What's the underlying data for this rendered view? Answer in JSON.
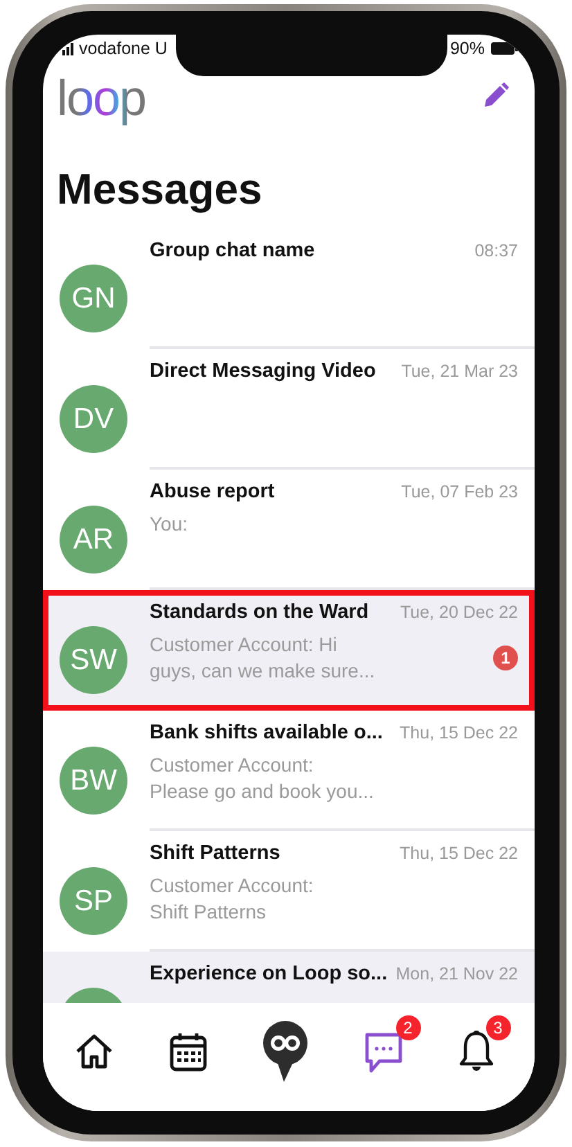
{
  "status_bar": {
    "carrier": "vodafone U",
    "battery": "90%"
  },
  "header": {
    "logo": "loop",
    "title": "Messages"
  },
  "conversations": [
    {
      "initials": "GN",
      "name": "Group chat name",
      "time": "08:37",
      "selected": false,
      "annotated": false
    },
    {
      "initials": "DV",
      "name": "Direct Messaging Video",
      "time": "Tue, 21 Mar 23",
      "selected": false,
      "annotated": false
    },
    {
      "initials": "AR",
      "name": "Abuse report",
      "time": "Tue, 07 Feb 23",
      "preview": "You:",
      "selected": false,
      "annotated": false
    },
    {
      "initials": "SW",
      "name": "Standards on the Ward",
      "time": "Tue, 20 Dec 22",
      "preview": "Customer Account: Hi\nguys, can we make sure...",
      "unread": "1",
      "selected": true,
      "annotated": true
    },
    {
      "initials": "BW",
      "name": "Bank shifts available o...",
      "time": "Thu, 15 Dec 22",
      "preview": "Customer Account:\nPlease go and book you...",
      "selected": false,
      "annotated": false
    },
    {
      "initials": "SP",
      "name": "Shift Patterns",
      "time": "Thu, 15 Dec 22",
      "preview": "Customer Account:\nShift Patterns",
      "selected": false,
      "annotated": false
    },
    {
      "name": "Experience on Loop so...",
      "time": "Mon, 21 Nov 22",
      "selected": true,
      "annotated": false
    }
  ],
  "nav": [
    {
      "kind": "home",
      "selected": false
    },
    {
      "kind": "calendar",
      "selected": false
    },
    {
      "kind": "logo",
      "selected": false
    },
    {
      "kind": "messages",
      "selected": true,
      "badge": "2"
    },
    {
      "kind": "notifications",
      "selected": false,
      "badge": "3"
    }
  ]
}
